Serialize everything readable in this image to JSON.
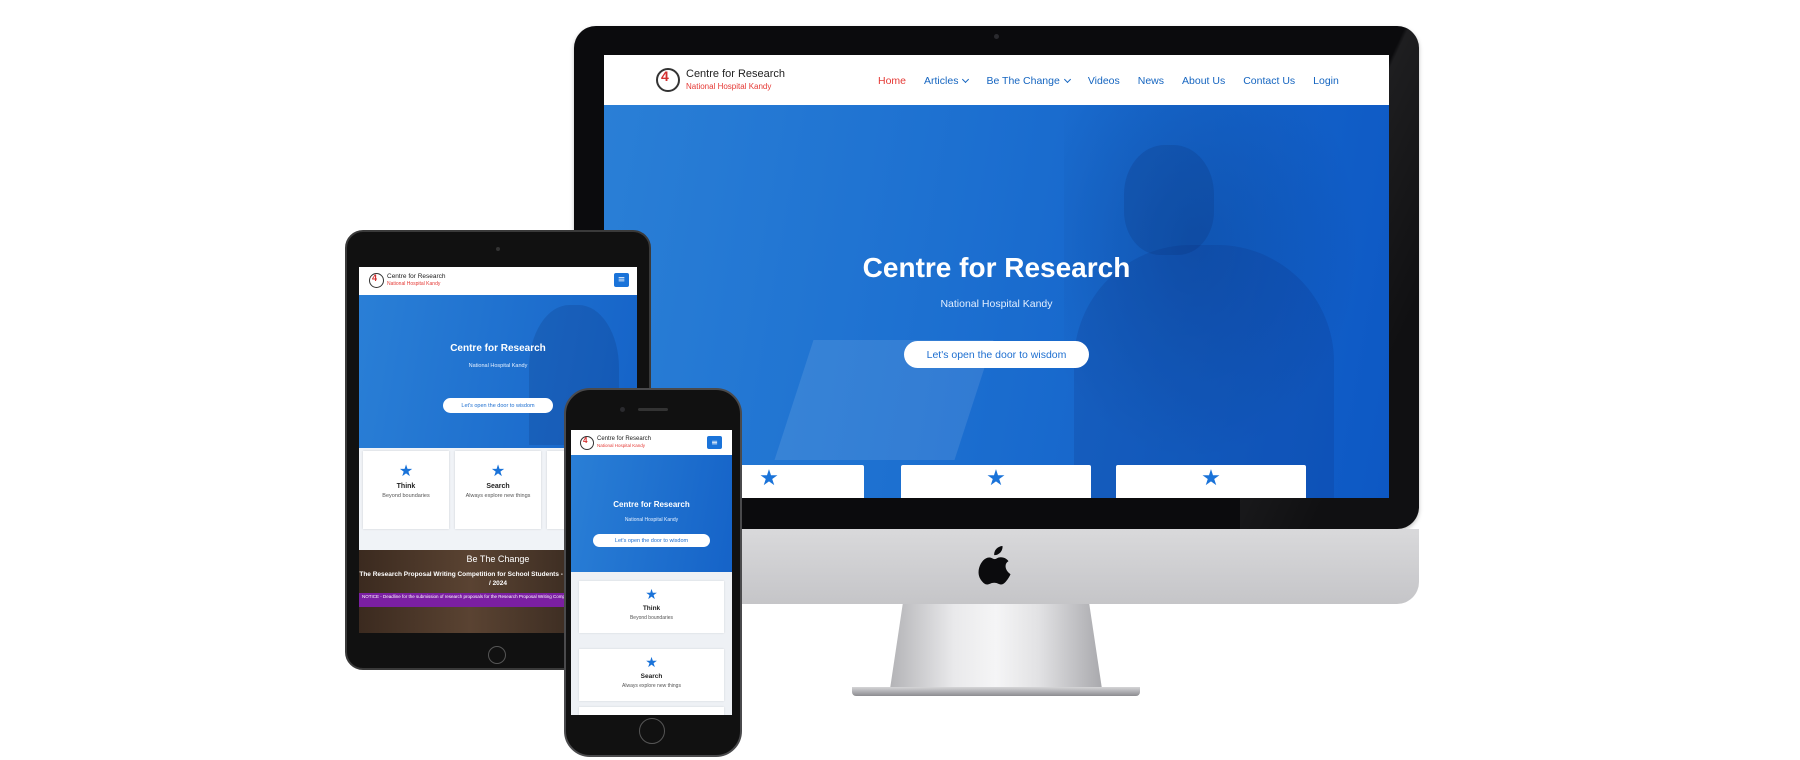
{
  "site": {
    "brand_line1": "Centre for Research",
    "brand_line2": "National Hospital Kandy",
    "logo_glyph": "4"
  },
  "nav": {
    "items": [
      "Home",
      "Articles",
      "Be The Change",
      "Videos",
      "News",
      "About Us",
      "Contact Us",
      "Login"
    ]
  },
  "hero": {
    "title": "Centre for Research",
    "subtitle": "National Hospital Kandy",
    "cta": "Let's open the door to wisdom"
  },
  "features": [
    {
      "title": "Think",
      "subtitle": "Beyond boundaries"
    },
    {
      "title": "Search",
      "subtitle": "Always explore new things"
    }
  ],
  "be_the_change": {
    "heading": "Be The Change",
    "title": "The Research Proposal Writing Competition for School Students - Central Province - 2023 / 2024",
    "notice": "NOTICE - Deadline for the submission of research proposals for the Research Proposal Writing Competition 2024"
  },
  "colors": {
    "brand_blue": "#1a73d9",
    "brand_red": "#e53935",
    "nav_link": "#1565c0"
  },
  "icons": {
    "card_icon": "star-icon",
    "menu_icon": "hamburger-menu-icon",
    "device_logo": "apple-logo-icon"
  }
}
